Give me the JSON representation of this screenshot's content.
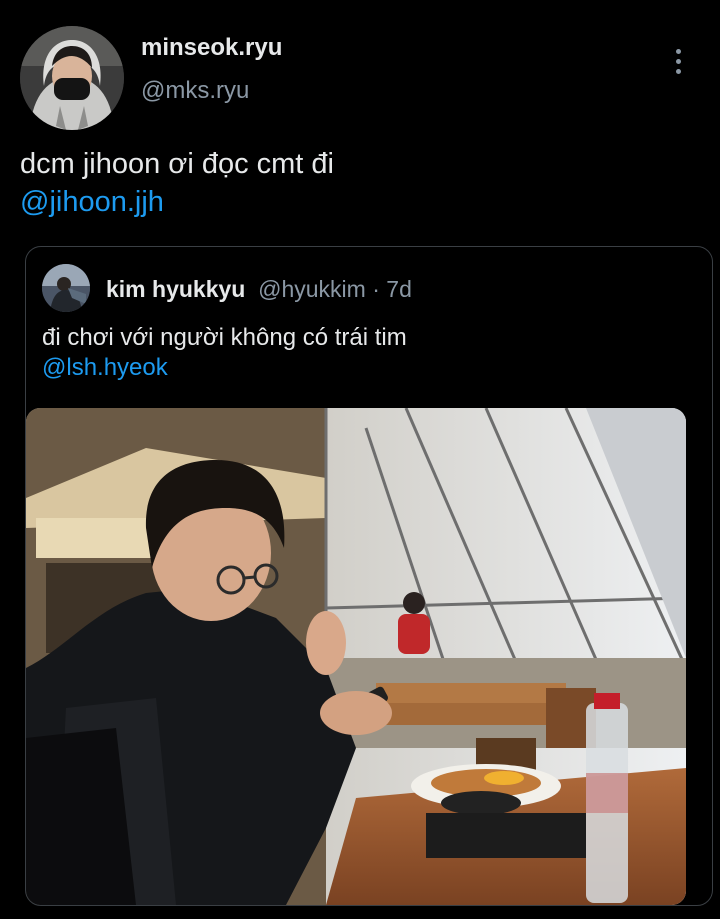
{
  "author": {
    "display_name": "minseok.ryu",
    "handle": "@mks.ryu"
  },
  "tweet": {
    "text_line1": "dcm jihoon ơi đọc cmt đi",
    "mention": "@jihoon.jjh"
  },
  "quoted": {
    "display_name": "kim hyukkyu",
    "handle": "@hyukkim",
    "separator": " · ",
    "age": "7d",
    "text_line1": "đi chơi với người không có trái tim",
    "mention": "@lsh.hyeok"
  },
  "icons": {
    "more": "more-vertical-icon"
  },
  "colors": {
    "background": "#000000",
    "text": "#e7e9ea",
    "secondary": "#8b98a5",
    "link": "#1d9bf0",
    "border": "#3a3f44"
  }
}
